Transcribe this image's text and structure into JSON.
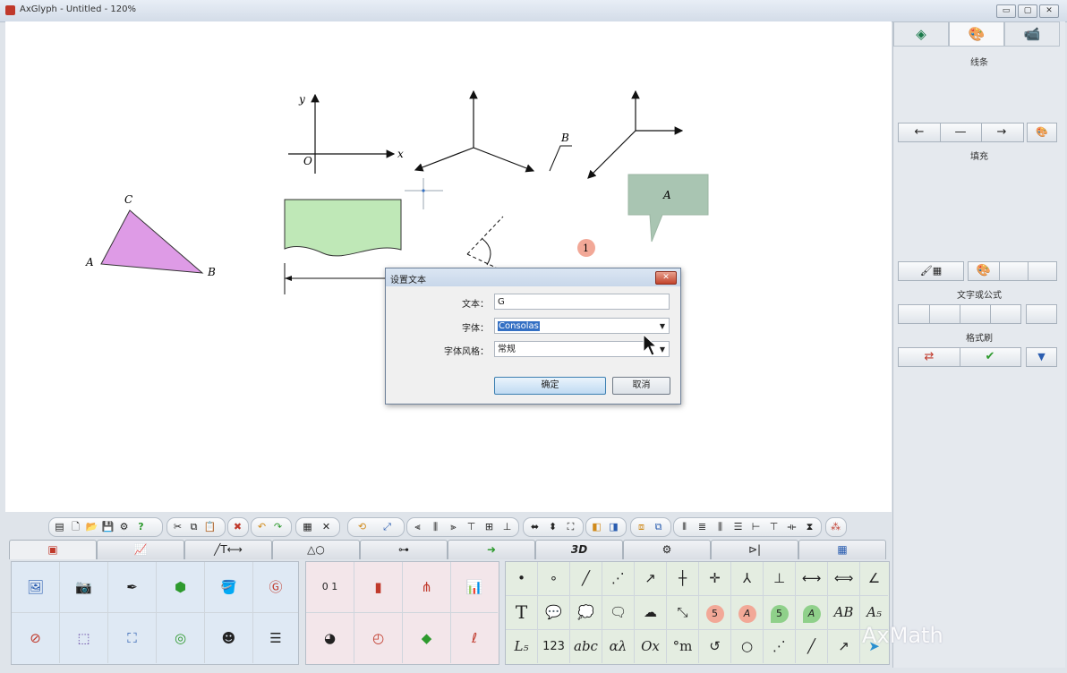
{
  "window": {
    "title": "AxGlyph - Untitled - 120%",
    "controls": [
      "▭",
      "▢",
      "✕"
    ]
  },
  "canvas": {
    "axis_labels": {
      "y": "y",
      "x": "x",
      "origin": "O"
    },
    "triangle_labels": {
      "a": "A",
      "b": "B",
      "c": "C"
    },
    "line_label": "B",
    "callout_text": "A",
    "badge_text": "1"
  },
  "right_panel": {
    "tabs": [
      "layers",
      "palette",
      "camera"
    ],
    "line_label": "线条",
    "line_buttons": [
      "←",
      "—",
      "→"
    ],
    "fill_label": "填充",
    "text_formula_label": "文字或公式",
    "format_brush_label": "格式刷"
  },
  "dialog": {
    "title": "设置文本",
    "close": "✕",
    "text_label": "文本：",
    "text_value": "G",
    "font_label": "字体：",
    "font_value": "Consolas",
    "style_label": "字体风格：",
    "style_value": "常规",
    "ok_label": "确定",
    "cancel_label": "取消"
  },
  "bottom_tabs": [
    "",
    "",
    "╱T⟷",
    "△○",
    "",
    "➜",
    "3D",
    "",
    "",
    ""
  ],
  "text_palette": {
    "row1": [
      "•",
      "∘",
      "╱",
      "⋰",
      "↗",
      "┼",
      "✛",
      "⅄",
      "⊥",
      "⟷",
      "⟺",
      "∠"
    ],
    "row2": [
      "T",
      "💬",
      "💭",
      "🗨",
      "☁",
      "⤡",
      "5",
      "A",
      "5",
      "A",
      "AB",
      "A₅"
    ],
    "row3": [
      "L₅",
      "123",
      "abc",
      "αλ",
      "Ox",
      "°m",
      "↺",
      "○",
      "⋰",
      "╱",
      "↗",
      ""
    ]
  },
  "watermark": "AxMath"
}
